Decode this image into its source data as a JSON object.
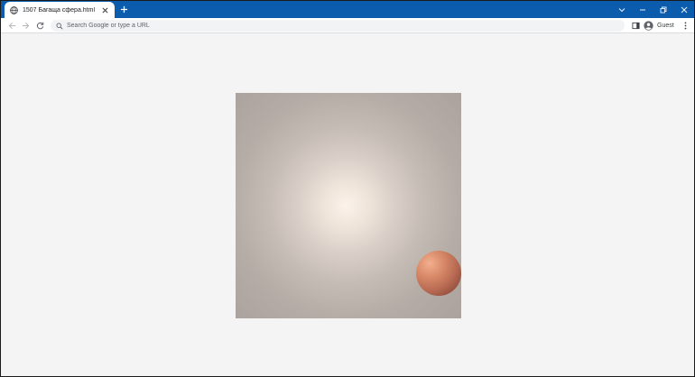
{
  "browser": {
    "tab": {
      "title": "1507 Багаща сфера.html",
      "favicon": "globe-icon",
      "close_icon": "close-icon"
    },
    "new_tab_icon": "plus-icon",
    "window_controls": [
      "chevron-down-icon",
      "minimize-icon",
      "restore-icon",
      "close-icon"
    ],
    "toolbar": {
      "back_icon": "arrow-left-icon",
      "forward_icon": "arrow-right-icon",
      "reload_icon": "reload-icon",
      "omnibox_placeholder": "Search Google or type a URL",
      "omnibox_value": "",
      "side_panel_icon": "side-panel-icon",
      "profile_label": "Guest",
      "menu_icon": "kebab-menu-icon"
    },
    "colors": {
      "titlebar": "#0b5cad",
      "page_background": "#f4f4f4",
      "sphere": "#c87a5c"
    }
  }
}
